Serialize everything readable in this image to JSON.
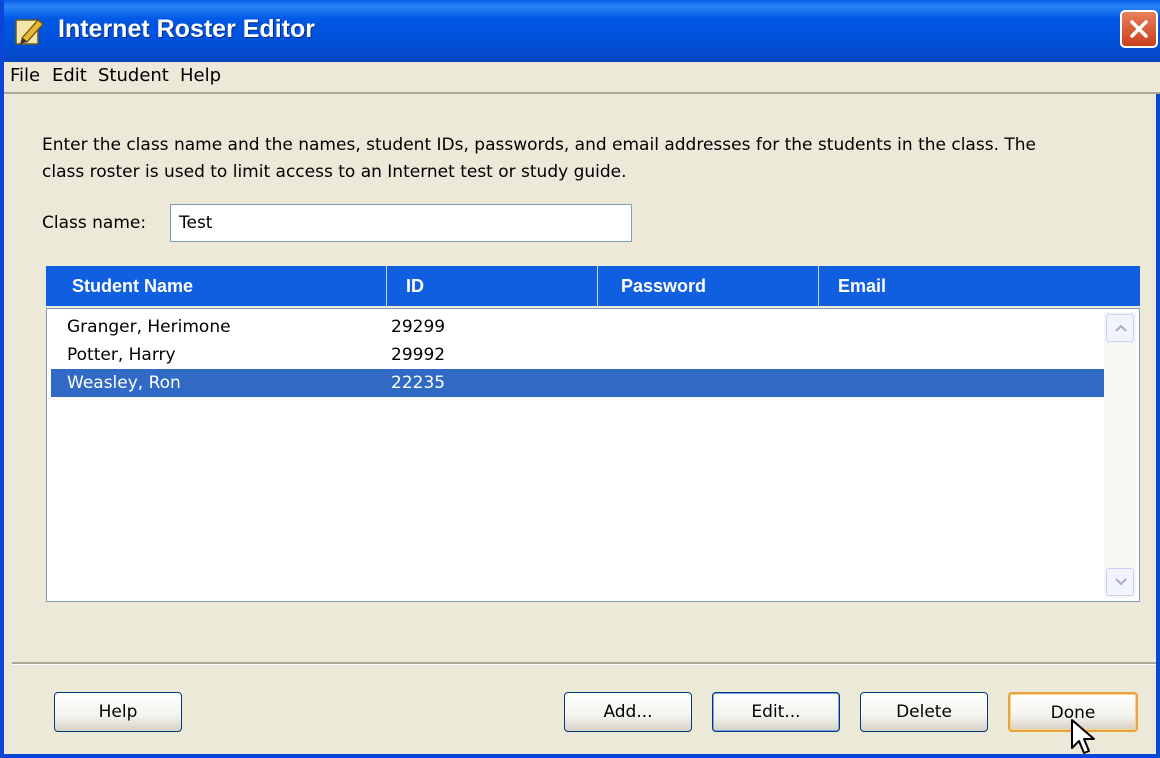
{
  "window": {
    "title": "Internet Roster Editor"
  },
  "menu": [
    "File",
    "Edit",
    "Student",
    "Help"
  ],
  "instructions": {
    "line1": "Enter the class name and the names, student IDs, passwords, and email addresses for the students in the class.  The",
    "line2": "class roster is used to limit access to an Internet test or study guide."
  },
  "class_name": {
    "label": "Class name:",
    "value": "Test"
  },
  "table": {
    "columns": [
      "Student Name",
      "ID",
      "Password",
      "Email"
    ],
    "rows": [
      {
        "name": "Granger, Herimone",
        "id": "29299",
        "password": "",
        "email": ""
      },
      {
        "name": "Potter, Harry",
        "id": "29992",
        "password": "",
        "email": ""
      },
      {
        "name": "Weasley, Ron",
        "id": "22235",
        "password": "",
        "email": ""
      }
    ],
    "selected_row": 2
  },
  "buttons": {
    "help": "Help",
    "add": "Add...",
    "edit": "Edit...",
    "delete": "Delete",
    "done": "Done"
  },
  "colors": {
    "titlebar": "#0058e6",
    "header": "#0f5fe0",
    "selection": "#316ac5",
    "close": "#c9411c"
  }
}
